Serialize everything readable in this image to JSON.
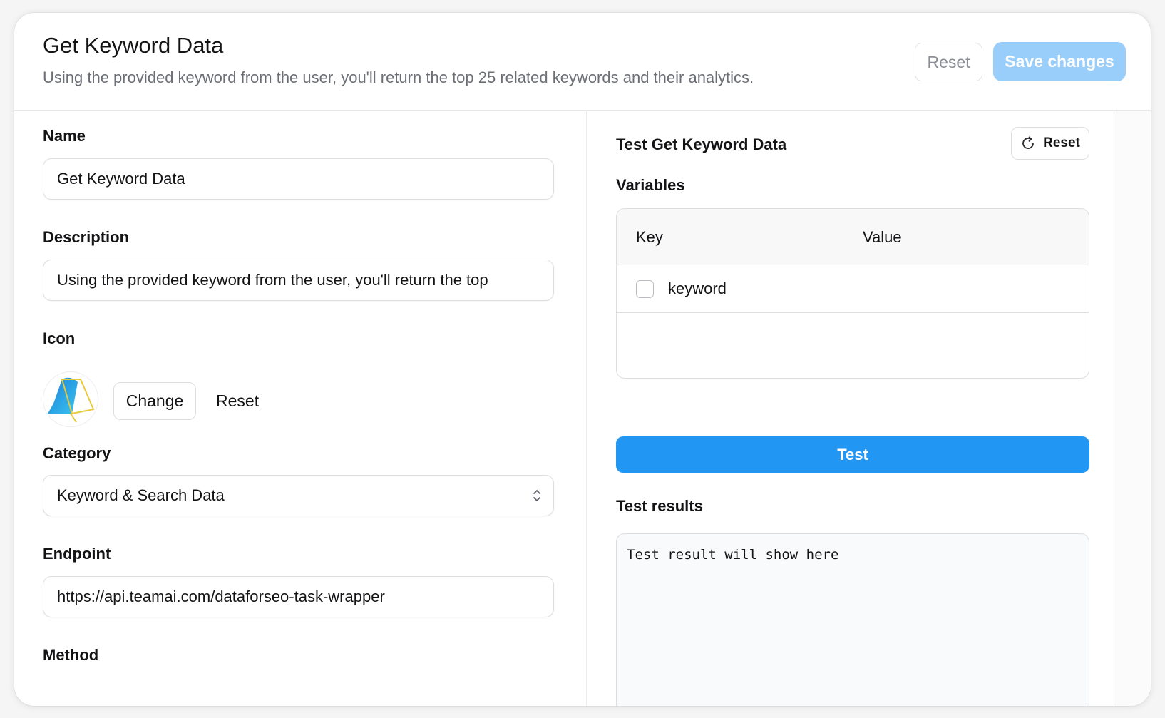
{
  "header": {
    "title": "Get Keyword Data",
    "subtitle": "Using the provided keyword from the user, you'll return the top 25 related keywords and their analytics.",
    "reset_label": "Reset",
    "save_label": "Save changes"
  },
  "form": {
    "name": {
      "label": "Name",
      "value": "Get Keyword Data"
    },
    "description": {
      "label": "Description",
      "value": "Using the provided keyword from the user, you'll return the top"
    },
    "icon": {
      "label": "Icon",
      "change_label": "Change",
      "reset_label": "Reset"
    },
    "category": {
      "label": "Category",
      "value": "Keyword & Search Data"
    },
    "endpoint": {
      "label": "Endpoint",
      "value": "https://api.teamai.com/dataforseo-task-wrapper"
    },
    "method": {
      "label": "Method"
    }
  },
  "test_panel": {
    "title": "Test Get Keyword Data",
    "reset_label": "Reset",
    "variables_label": "Variables",
    "columns": {
      "key": "Key",
      "value": "Value"
    },
    "rows": [
      {
        "key": "keyword",
        "checked": false
      }
    ],
    "test_button": "Test",
    "results_label": "Test results",
    "results_placeholder": "Test result will show here"
  },
  "colors": {
    "primary": "#2196f3",
    "primary_disabled": "#99cdfa",
    "border": "#dcdde0",
    "muted_text": "#6b6e75"
  }
}
